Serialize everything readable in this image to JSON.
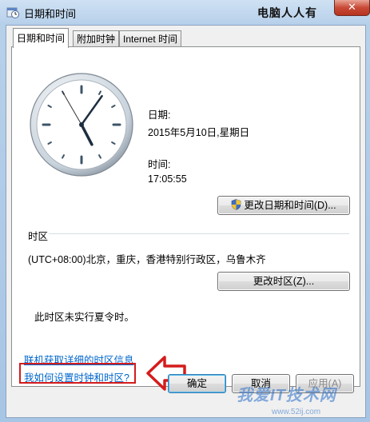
{
  "window": {
    "title": "日期和时间",
    "watermark_top": "电脑人人有",
    "close_label": "✕"
  },
  "tabs": [
    {
      "label": "日期和时间",
      "active": true
    },
    {
      "label": "附加时钟",
      "active": false
    },
    {
      "label": "Internet 时间",
      "active": false
    }
  ],
  "clock": {
    "hour": 17,
    "minute": 5,
    "second": 55
  },
  "date": {
    "label": "日期:",
    "value": "2015年5月10日,星期日"
  },
  "time": {
    "label": "时间:",
    "value": "17:05:55"
  },
  "buttons": {
    "change_datetime": "更改日期和时间(D)...",
    "change_timezone": "更改时区(Z)...",
    "ok": "确定",
    "cancel": "取消",
    "apply": "应用(A)"
  },
  "timezone": {
    "heading": "时区",
    "value": "(UTC+08:00)北京，重庆，香港特别行政区，乌鲁木齐",
    "dst_note": "此时区未实行夏令时。"
  },
  "links": {
    "online_info": "联机获取详细的时区信息",
    "howto": "我如何设置时钟和时区?"
  },
  "watermark_bottom": "我爱IT技术网",
  "watermark_sub": "www.52ij.com",
  "colors": {
    "link": "#0066cc",
    "highlight": "#d41c1c",
    "close": "#c94a36"
  }
}
